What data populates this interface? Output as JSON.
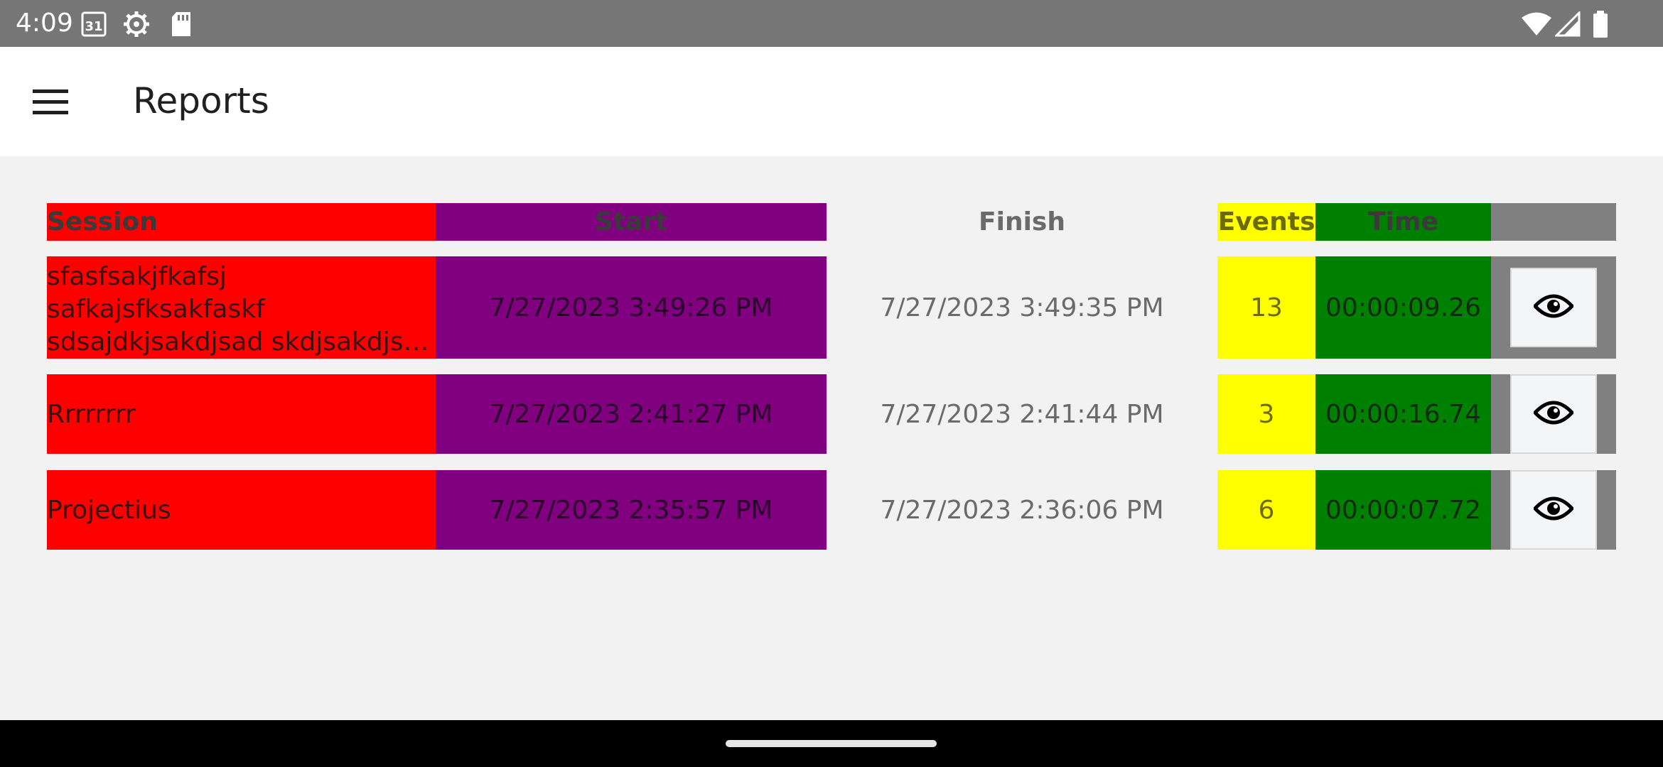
{
  "status_bar": {
    "time": "4:09",
    "calendar_day": "31",
    "icons": [
      "calendar-icon",
      "settings-gear-icon",
      "sd-card-icon",
      "wifi-icon",
      "signal-icon",
      "battery-icon"
    ]
  },
  "app_bar": {
    "title": "Reports",
    "menu_icon": "hamburger-menu-icon"
  },
  "table": {
    "headers": {
      "session": "Session",
      "start": "Start",
      "finish": "Finish",
      "events": "Events",
      "time": "Time"
    },
    "rows": [
      {
        "session_lines": [
          "sfasfsakjfkafsj",
          "safkajsfksakfaskf",
          "sdsajdkjsakdjsad skdjsakdjsa…"
        ],
        "start": "7/27/2023 3:49:26 PM",
        "finish": "7/27/2023 3:49:35 PM",
        "events": "13",
        "time": "00:00:09.26"
      },
      {
        "session": "Rrrrrrrr",
        "start": "7/27/2023 2:41:27 PM",
        "finish": "7/27/2023 2:41:44 PM",
        "events": "3",
        "time": "00:00:16.74"
      },
      {
        "session": "Projectius",
        "start": "7/27/2023 2:35:57 PM",
        "finish": "7/27/2023 2:36:06 PM",
        "events": "6",
        "time": "00:00:07.72"
      }
    ],
    "view_icon": "eye-icon"
  },
  "colors": {
    "session": "#ff0000",
    "start": "#800080",
    "events": "#ffff00",
    "time": "#008000",
    "actions": "#808080",
    "status_bar": "#767676"
  }
}
